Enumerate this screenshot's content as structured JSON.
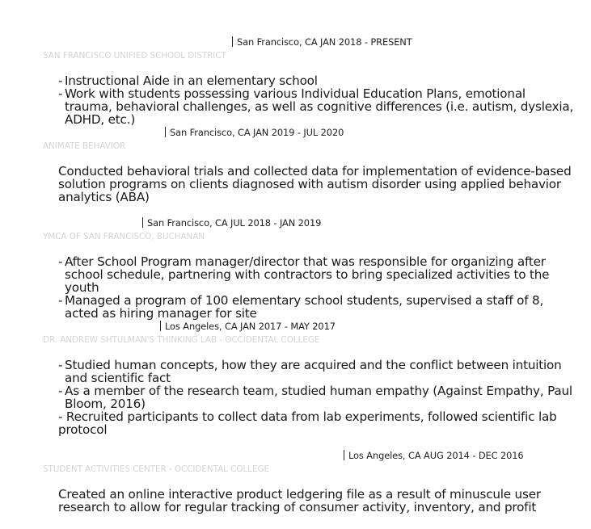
{
  "entries": [
    {
      "location_date": "San Francisco, CA JAN 2018 - PRESENT",
      "organization": "SAN FRANCISCO UNIFIED SCHOOL DISTRICT",
      "bullets": [
        "Instructional Aide in an elementary school",
        "Work with students possessing various Individual Education Plans, emotional trauma, behavioral challenges, as well as cognitive differences (i.e. autism, dyslexia, ADHD, etc.)"
      ]
    },
    {
      "location_date": "San Francisco, CA JAN 2019 - JUL 2020",
      "organization": "ANIMATE BEHAVIOR",
      "paragraph": "Conducted behavioral trials and collected data for implementation of evidence-based solution programs on clients diagnosed with autism disorder using applied behavior analytics (ABA)"
    },
    {
      "location_date": "San Francisco, CA JUL 2018 - JAN 2019",
      "organization": "YMCA OF SAN FRANCISCO, BUCHANAN",
      "bullets": [
        "After School Program manager/director that was responsible for organizing after school schedule, partnering with contractors to bring specialized activities to the youth",
        "Managed a program of 100 elementary school students, supervised a staff of 8, acted as hiring manager for site"
      ]
    },
    {
      "location_date": "Los Angeles, CA JAN 2017 - MAY 2017",
      "organization": "DR. ANDREW SHTULMAN'S THINKING LAB - OCCIDENTAL COLLEGE",
      "bullets": [
        "Studied human concepts, how they are acquired and the conflict between intuition and scientific fact",
        "As a member of the research team, studied human empathy (Against Empathy, Paul Bloom, 2016)"
      ],
      "bullet_last": "Recruited participants to collect data from lab experiments, followed scientific lab",
      "bullet_last_cont": "protocol"
    },
    {
      "location_date": "Los Angeles, CA AUG 2014 - DEC 2016",
      "organization": "STUDENT ACTIVITIES CENTER - OCCIDENTAL COLLEGE",
      "paragraph": "Created an online interactive product ledgering file as a result of minuscule user research to allow for regular tracking of consumer activity, inventory, and profit"
    }
  ]
}
